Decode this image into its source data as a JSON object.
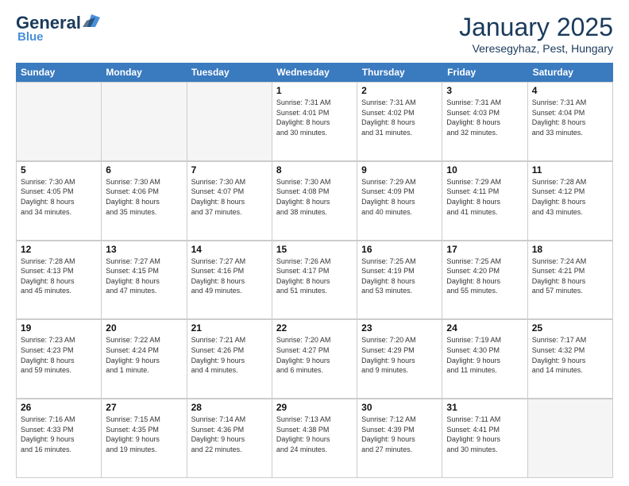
{
  "header": {
    "logo_general": "General",
    "logo_blue": "Blue",
    "title": "January 2025",
    "subtitle": "Veresegyhaz, Pest, Hungary"
  },
  "calendar": {
    "days_of_week": [
      "Sunday",
      "Monday",
      "Tuesday",
      "Wednesday",
      "Thursday",
      "Friday",
      "Saturday"
    ],
    "weeks": [
      [
        {
          "day": "",
          "info": "",
          "empty": true
        },
        {
          "day": "",
          "info": "",
          "empty": true
        },
        {
          "day": "",
          "info": "",
          "empty": true
        },
        {
          "day": "1",
          "info": "Sunrise: 7:31 AM\nSunset: 4:01 PM\nDaylight: 8 hours\nand 30 minutes."
        },
        {
          "day": "2",
          "info": "Sunrise: 7:31 AM\nSunset: 4:02 PM\nDaylight: 8 hours\nand 31 minutes."
        },
        {
          "day": "3",
          "info": "Sunrise: 7:31 AM\nSunset: 4:03 PM\nDaylight: 8 hours\nand 32 minutes."
        },
        {
          "day": "4",
          "info": "Sunrise: 7:31 AM\nSunset: 4:04 PM\nDaylight: 8 hours\nand 33 minutes."
        }
      ],
      [
        {
          "day": "5",
          "info": "Sunrise: 7:30 AM\nSunset: 4:05 PM\nDaylight: 8 hours\nand 34 minutes."
        },
        {
          "day": "6",
          "info": "Sunrise: 7:30 AM\nSunset: 4:06 PM\nDaylight: 8 hours\nand 35 minutes."
        },
        {
          "day": "7",
          "info": "Sunrise: 7:30 AM\nSunset: 4:07 PM\nDaylight: 8 hours\nand 37 minutes."
        },
        {
          "day": "8",
          "info": "Sunrise: 7:30 AM\nSunset: 4:08 PM\nDaylight: 8 hours\nand 38 minutes."
        },
        {
          "day": "9",
          "info": "Sunrise: 7:29 AM\nSunset: 4:09 PM\nDaylight: 8 hours\nand 40 minutes."
        },
        {
          "day": "10",
          "info": "Sunrise: 7:29 AM\nSunset: 4:11 PM\nDaylight: 8 hours\nand 41 minutes."
        },
        {
          "day": "11",
          "info": "Sunrise: 7:28 AM\nSunset: 4:12 PM\nDaylight: 8 hours\nand 43 minutes."
        }
      ],
      [
        {
          "day": "12",
          "info": "Sunrise: 7:28 AM\nSunset: 4:13 PM\nDaylight: 8 hours\nand 45 minutes."
        },
        {
          "day": "13",
          "info": "Sunrise: 7:27 AM\nSunset: 4:15 PM\nDaylight: 8 hours\nand 47 minutes."
        },
        {
          "day": "14",
          "info": "Sunrise: 7:27 AM\nSunset: 4:16 PM\nDaylight: 8 hours\nand 49 minutes."
        },
        {
          "day": "15",
          "info": "Sunrise: 7:26 AM\nSunset: 4:17 PM\nDaylight: 8 hours\nand 51 minutes."
        },
        {
          "day": "16",
          "info": "Sunrise: 7:25 AM\nSunset: 4:19 PM\nDaylight: 8 hours\nand 53 minutes."
        },
        {
          "day": "17",
          "info": "Sunrise: 7:25 AM\nSunset: 4:20 PM\nDaylight: 8 hours\nand 55 minutes."
        },
        {
          "day": "18",
          "info": "Sunrise: 7:24 AM\nSunset: 4:21 PM\nDaylight: 8 hours\nand 57 minutes."
        }
      ],
      [
        {
          "day": "19",
          "info": "Sunrise: 7:23 AM\nSunset: 4:23 PM\nDaylight: 8 hours\nand 59 minutes."
        },
        {
          "day": "20",
          "info": "Sunrise: 7:22 AM\nSunset: 4:24 PM\nDaylight: 9 hours\nand 1 minute."
        },
        {
          "day": "21",
          "info": "Sunrise: 7:21 AM\nSunset: 4:26 PM\nDaylight: 9 hours\nand 4 minutes."
        },
        {
          "day": "22",
          "info": "Sunrise: 7:20 AM\nSunset: 4:27 PM\nDaylight: 9 hours\nand 6 minutes."
        },
        {
          "day": "23",
          "info": "Sunrise: 7:20 AM\nSunset: 4:29 PM\nDaylight: 9 hours\nand 9 minutes."
        },
        {
          "day": "24",
          "info": "Sunrise: 7:19 AM\nSunset: 4:30 PM\nDaylight: 9 hours\nand 11 minutes."
        },
        {
          "day": "25",
          "info": "Sunrise: 7:17 AM\nSunset: 4:32 PM\nDaylight: 9 hours\nand 14 minutes."
        }
      ],
      [
        {
          "day": "26",
          "info": "Sunrise: 7:16 AM\nSunset: 4:33 PM\nDaylight: 9 hours\nand 16 minutes."
        },
        {
          "day": "27",
          "info": "Sunrise: 7:15 AM\nSunset: 4:35 PM\nDaylight: 9 hours\nand 19 minutes."
        },
        {
          "day": "28",
          "info": "Sunrise: 7:14 AM\nSunset: 4:36 PM\nDaylight: 9 hours\nand 22 minutes."
        },
        {
          "day": "29",
          "info": "Sunrise: 7:13 AM\nSunset: 4:38 PM\nDaylight: 9 hours\nand 24 minutes."
        },
        {
          "day": "30",
          "info": "Sunrise: 7:12 AM\nSunset: 4:39 PM\nDaylight: 9 hours\nand 27 minutes."
        },
        {
          "day": "31",
          "info": "Sunrise: 7:11 AM\nSunset: 4:41 PM\nDaylight: 9 hours\nand 30 minutes."
        },
        {
          "day": "",
          "info": "",
          "empty": true
        }
      ]
    ]
  }
}
